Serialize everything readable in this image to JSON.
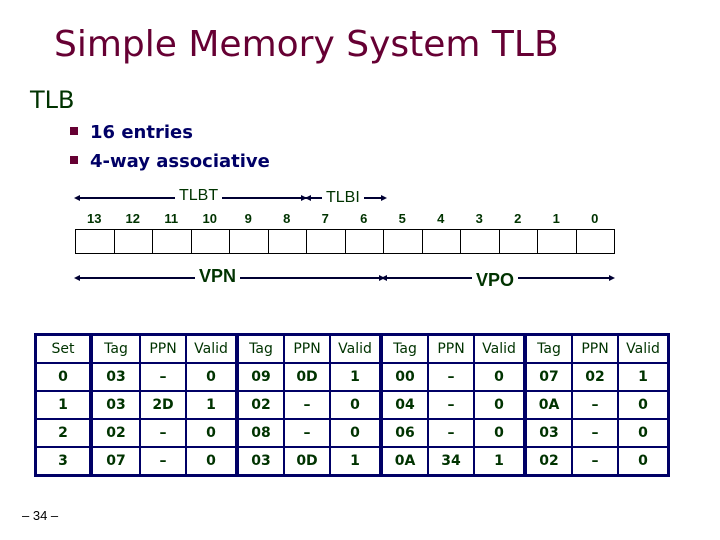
{
  "slide": {
    "title": "Simple Memory System TLB",
    "heading": "TLB",
    "bullets": [
      "16 entries",
      "4-way associative"
    ],
    "page_number": "– 34 –"
  },
  "address": {
    "bits": [
      "13",
      "12",
      "11",
      "10",
      "9",
      "8",
      "7",
      "6",
      "5",
      "4",
      "3",
      "2",
      "1",
      "0"
    ],
    "field_labels": {
      "tlbt": "TLBT",
      "tlbi": "TLBI",
      "vpn": "VPN",
      "vpo": "VPO"
    }
  },
  "tlb_table": {
    "headers": [
      "Set",
      "Tag",
      "PPN",
      "Valid",
      "Tag",
      "PPN",
      "Valid",
      "Tag",
      "PPN",
      "Valid",
      "Tag",
      "PPN",
      "Valid"
    ],
    "rows": [
      [
        "0",
        "03",
        "–",
        "0",
        "09",
        "0D",
        "1",
        "00",
        "–",
        "0",
        "07",
        "02",
        "1"
      ],
      [
        "1",
        "03",
        "2D",
        "1",
        "02",
        "–",
        "0",
        "04",
        "–",
        "0",
        "0A",
        "–",
        "0"
      ],
      [
        "2",
        "02",
        "–",
        "0",
        "08",
        "–",
        "0",
        "06",
        "–",
        "0",
        "03",
        "–",
        "0"
      ],
      [
        "3",
        "07",
        "–",
        "0",
        "03",
        "0D",
        "1",
        "0A",
        "34",
        "1",
        "02",
        "–",
        "0"
      ]
    ]
  },
  "colors": {
    "title": "#660033",
    "heading": "#003300",
    "bullet_text": "#000066",
    "table_border": "#000066",
    "table_text": "#003300"
  }
}
